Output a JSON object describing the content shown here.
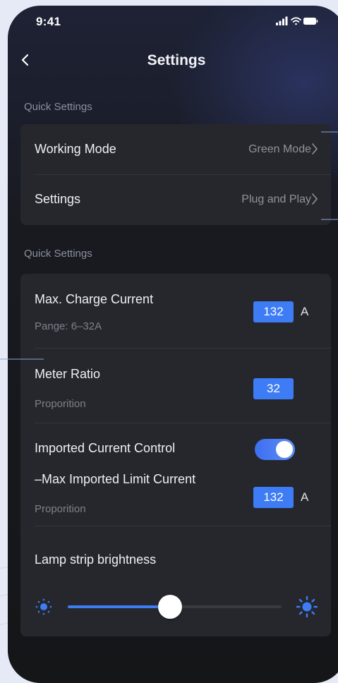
{
  "status_bar": {
    "time": "9:41"
  },
  "nav": {
    "title": "Settings"
  },
  "sections": [
    {
      "label": "Quick Settings"
    },
    {
      "label": "Quick Settings"
    }
  ],
  "quick_card": {
    "rows": [
      {
        "label": "Working Mode",
        "value": "Green Mode"
      },
      {
        "label": "Settings",
        "value": "Plug and Play"
      }
    ]
  },
  "charge_card": {
    "max_charge": {
      "label": "Max. Charge Current",
      "sub": "Pange: 6–32A",
      "value": "132",
      "unit": "A"
    },
    "meter_ratio": {
      "label": "Meter Ratio",
      "sub": "Proporition",
      "value": "32"
    },
    "imported_control": {
      "label": "Imported Current Control",
      "enabled": true
    },
    "max_imported": {
      "label": "–Max Imported Limit Current",
      "sub": "Proporition",
      "value": "132",
      "unit": "A"
    },
    "lamp": {
      "label": "Lamp strip brightness",
      "level": 0.48
    }
  },
  "icons": [
    "back-chevron-icon",
    "signal-icon",
    "wifi-icon",
    "battery-icon",
    "chevron-right-icon",
    "sun-dim-icon",
    "sun-bright-icon"
  ],
  "colors": {
    "accent": "#3d7cf5",
    "card": "#26272c",
    "background": "#151618"
  }
}
